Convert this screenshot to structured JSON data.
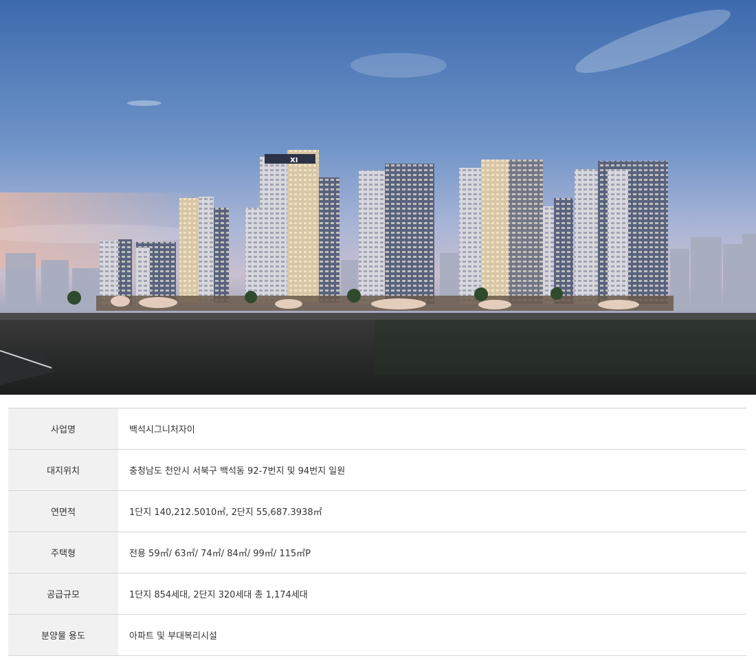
{
  "hero": {
    "image": "apartment-complex-night-rendering",
    "sky_top_color": "#3f6fb0",
    "sky_bottom_color": "#c7c9dc",
    "ground_color": "#1f2021"
  },
  "specs": [
    {
      "label": "사업명",
      "value": "백석시그니처자이"
    },
    {
      "label": "대지위치",
      "value": "충청남도 천안시 서북구 백석동 92-7번지 및 94번지 일원"
    },
    {
      "label": "연면적",
      "value": "1단지 140,212.5010㎡, 2단지 55,687.3938㎡"
    },
    {
      "label": "주택형",
      "value": "전용 59㎡/ 63㎡/ 74㎡/ 84㎡/ 99㎡/ 115㎡P"
    },
    {
      "label": "공급규모",
      "value": "1단지 854세대, 2단지 320세대 총 1,174세대"
    },
    {
      "label": "분양물 용도",
      "value": "아파트 및 부대복리시설"
    }
  ]
}
